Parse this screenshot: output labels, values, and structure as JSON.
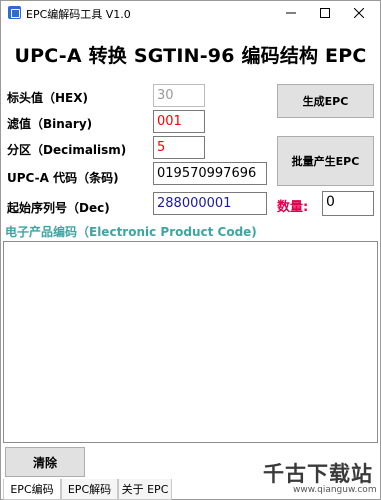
{
  "window": {
    "title": "EPC编解码工具 V1.0"
  },
  "heading": "UPC-A 转换 SGTIN-96 编码结构 EPC",
  "form": {
    "header_hex": {
      "label": "标头值（HEX)",
      "value": "30"
    },
    "filter": {
      "label": "滤值（Binary)",
      "value": "001"
    },
    "partition": {
      "label": "分区（Decimalism)",
      "value": "5"
    },
    "upc": {
      "label": "UPC-A 代码（条码)",
      "value": "019570997696"
    },
    "start_serial": {
      "label": "起始序列号（Dec)",
      "value": "288000001"
    },
    "quantity": {
      "label": "数量:",
      "value": "0"
    }
  },
  "buttons": {
    "generate": "生成EPC",
    "batch": "批量产生EPC",
    "clear": "清除"
  },
  "output": {
    "label": "电子产品编码（Electronic Product Code)",
    "content": ""
  },
  "tabs": [
    {
      "label": "EPC编码",
      "active": true
    },
    {
      "label": "EPC解码",
      "active": false
    },
    {
      "label": "关于 EPC",
      "active": false
    }
  ],
  "watermark": {
    "text": "千古下载站",
    "url": "www.qianguw.com"
  },
  "colors": {
    "filter_value": "#ff0000",
    "partition_value": "#ff0000",
    "serial_value": "#1a1aa0",
    "quantity_label": "#e0004d",
    "section_label": "#3fa5a2"
  }
}
